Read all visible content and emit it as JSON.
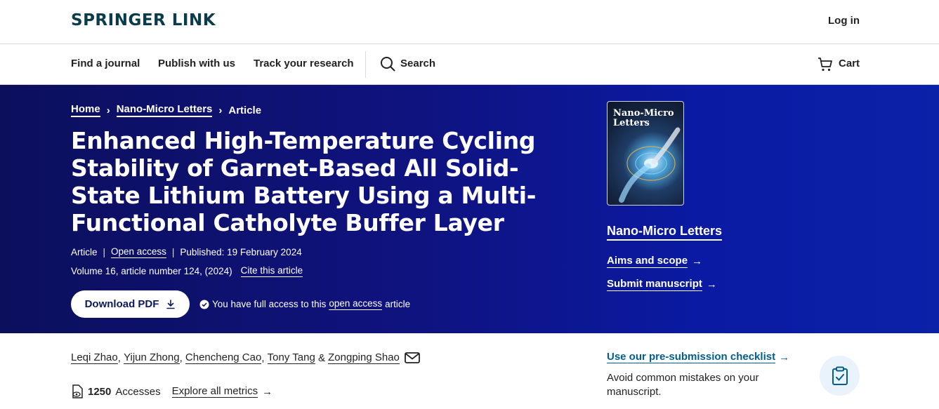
{
  "header": {
    "logo": "SPRINGER LINK",
    "login": "Log in"
  },
  "nav": {
    "items": [
      "Find a journal",
      "Publish with us",
      "Track your research"
    ],
    "search": "Search",
    "cart": "Cart"
  },
  "breadcrumb": {
    "home": "Home",
    "journal": "Nano-Micro Letters",
    "current": "Article"
  },
  "article": {
    "title": "Enhanced High-Temperature Cycling Stability of Garnet-Based All Solid-State Lithium Battery Using a Multi-Functional Catholyte Buffer Layer",
    "type": "Article",
    "open_access": "Open access",
    "published": "Published: 19 February 2024",
    "volume": "Volume 16, article number 124, (2024)",
    "cite": "Cite this article",
    "download": "Download PDF",
    "access_prefix": "You have full access to this",
    "access_link": "open access",
    "access_suffix": "article"
  },
  "journal_panel": {
    "cover_title_line1": "Nano-Micro",
    "cover_title_line2": "Letters",
    "name": "Nano-Micro Letters",
    "aims": "Aims and scope",
    "submit": "Submit manuscript"
  },
  "authors": [
    "Leqi Zhao",
    "Yijun Zhong",
    "Chencheng Cao",
    "Tony Tang",
    "Zongping Shao"
  ],
  "metrics": {
    "count": "1250",
    "label": "Accesses",
    "explore": "Explore all metrics"
  },
  "checklist": {
    "link": "Use our pre-submission checklist",
    "text": "Avoid common mistakes on your manuscript."
  },
  "colors": {
    "hero": "#0f1380",
    "accent_link": "#025e8d",
    "logo": "#0a3c4c"
  }
}
